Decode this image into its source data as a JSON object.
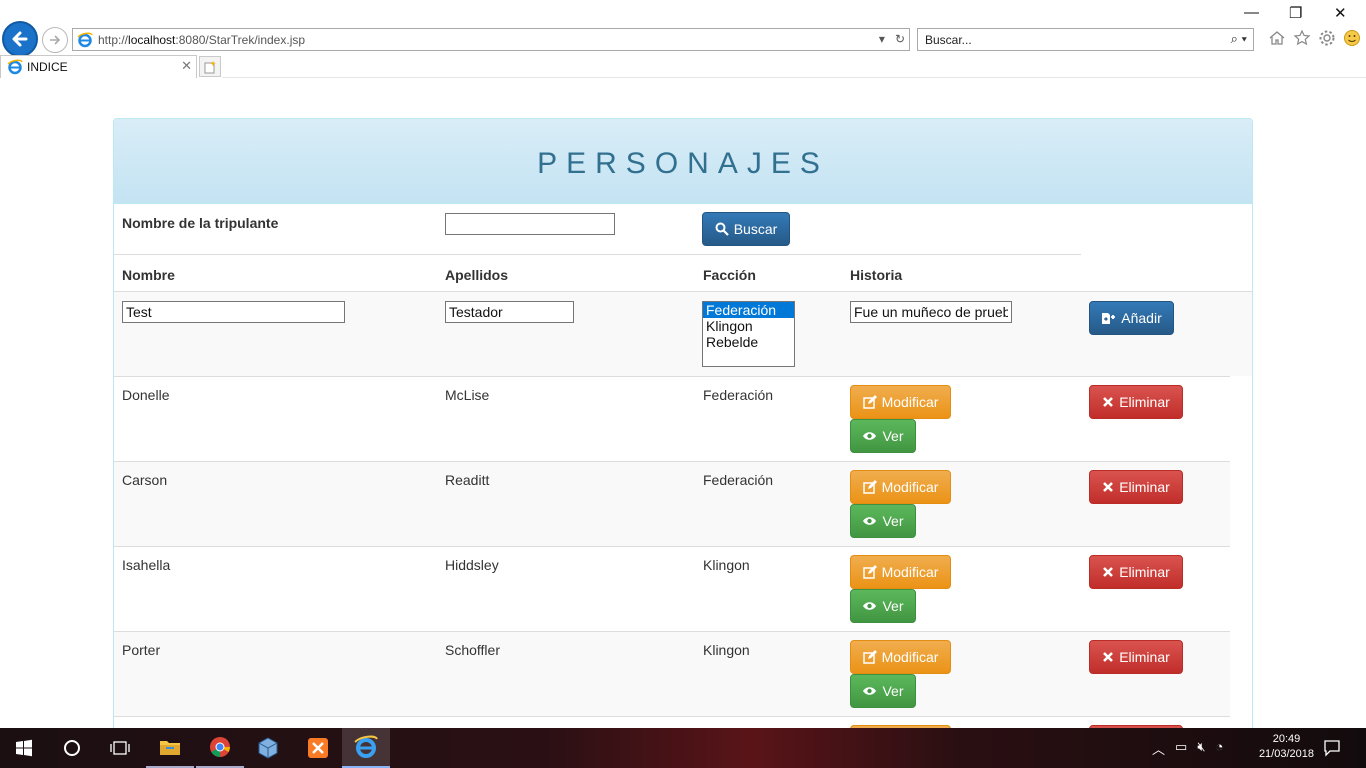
{
  "browser": {
    "url_prefix": "http://",
    "url_host": "localhost",
    "url_rest": ":8080/StarTrek/index.jsp",
    "search_placeholder": "Buscar...",
    "tab_title": "INDICE"
  },
  "page": {
    "title": "PERSONAJES",
    "search": {
      "label": "Nombre de la tripulante",
      "value": "",
      "button_label": "Buscar"
    },
    "columns": [
      "Nombre",
      "Apellidos",
      "Facción",
      "Historia"
    ],
    "new_row": {
      "nombre": "Test",
      "apellidos": "Testador",
      "faccion_options": [
        "Federación",
        "Klingon",
        "Rebelde"
      ],
      "faccion_selected": "Federación",
      "historia": "Fue un muñeco de prueb",
      "add_label": "Añadir"
    },
    "actions": {
      "modify_label": "Modificar",
      "view_label": "Ver",
      "delete_label": "Eliminar"
    },
    "rows": [
      {
        "nombre": "Donelle",
        "apellidos": "McLise",
        "faccion": "Federación"
      },
      {
        "nombre": "Carson",
        "apellidos": "Readitt",
        "faccion": "Federación"
      },
      {
        "nombre": "Isahella",
        "apellidos": "Hiddsley",
        "faccion": "Klingon"
      },
      {
        "nombre": "Porter",
        "apellidos": "Schoffler",
        "faccion": "Klingon"
      }
    ]
  },
  "taskbar": {
    "time": "20:49",
    "date": "21/03/2018"
  },
  "colors": {
    "primary": "#337ab7",
    "warning": "#f0ad4e",
    "success": "#5cb85c",
    "danger": "#d9534f",
    "heading_text": "#31708f"
  }
}
